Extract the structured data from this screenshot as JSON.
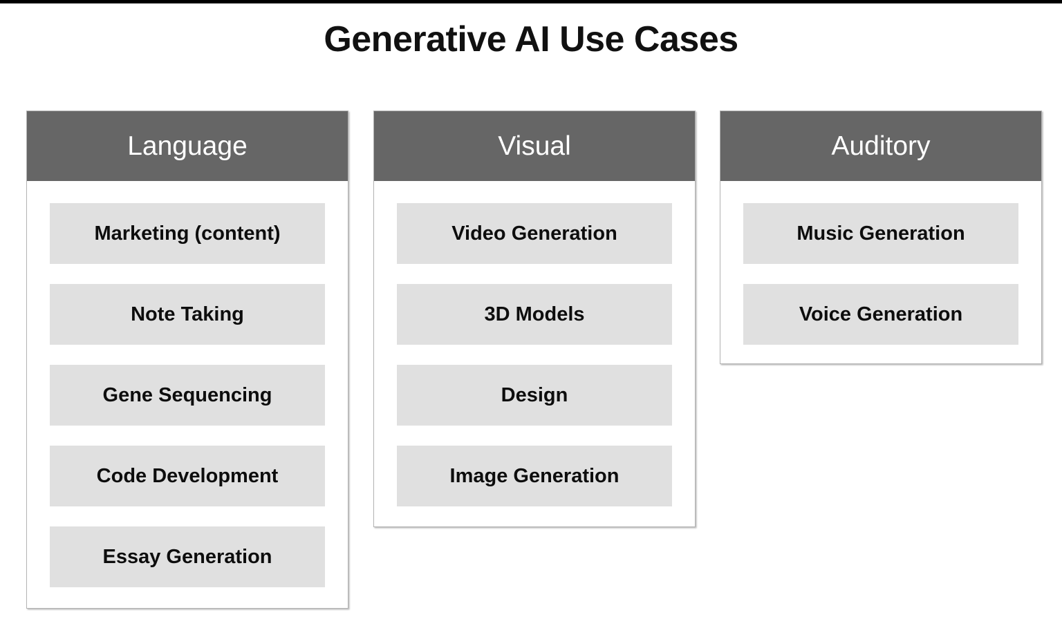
{
  "slide": {
    "title": "Generative AI Use Cases",
    "background_color": "#ffffff",
    "title_color": "#111111",
    "header_color": "#666666",
    "header_text_color": "#ffffff",
    "item_color": "#e0e0e0",
    "item_text_color": "#0d0d0d",
    "card_border_color": "#b3b3b3"
  },
  "columns": [
    {
      "header": "Language",
      "items": [
        {
          "label": "Marketing (content)"
        },
        {
          "label": "Note Taking"
        },
        {
          "label": "Gene Sequencing"
        },
        {
          "label": "Code Development"
        },
        {
          "label": "Essay Generation"
        }
      ]
    },
    {
      "header": "Visual",
      "items": [
        {
          "label": "Video Generation"
        },
        {
          "label": "3D Models"
        },
        {
          "label": "Design"
        },
        {
          "label": "Image Generation"
        }
      ]
    },
    {
      "header": "Auditory",
      "items": [
        {
          "label": "Music Generation"
        },
        {
          "label": "Voice Generation"
        }
      ]
    }
  ]
}
